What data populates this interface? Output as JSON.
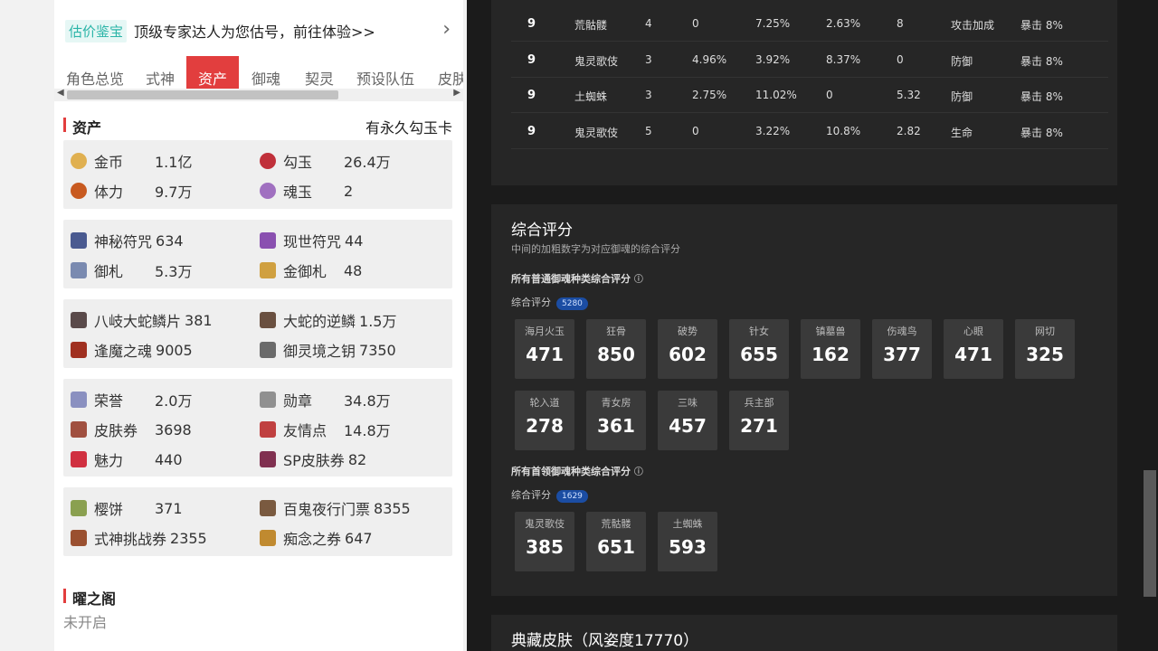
{
  "banner": {
    "tag": "估价鉴宝",
    "text": "顶级专家达人为您估号，前往体验>>",
    "chevron": "›"
  },
  "tabs": [
    "角色总览",
    "式神",
    "资产",
    "御魂",
    "契灵",
    "预设队伍",
    "皮肤"
  ],
  "active_tab": "资产",
  "assets_section": {
    "title": "资产",
    "right": "有永久勾玉卡"
  },
  "groups": [
    [
      {
        "name": "金币",
        "value": "1.1亿",
        "icon": "coin-icon",
        "color": "#e0b050"
      },
      {
        "name": "勾玉",
        "value": "26.4万",
        "icon": "jade-icon",
        "color": "#c0303a"
      },
      {
        "name": "体力",
        "value": "9.7万",
        "icon": "stamina-icon",
        "color": "#c85a20"
      },
      {
        "name": "魂玉",
        "value": "2",
        "icon": "soul-jade-icon",
        "color": "#a070c0"
      }
    ],
    [
      {
        "name": "神秘符咒",
        "value": "634",
        "icon": "mystery-talisman-icon",
        "color": "#4a5a90",
        "inline": true
      },
      {
        "name": "现世符咒",
        "value": "44",
        "icon": "reality-talisman-icon",
        "color": "#8a50b0",
        "inline": true
      },
      {
        "name": "御札",
        "value": "5.3万",
        "icon": "ofuda-icon",
        "color": "#7a8ab0"
      },
      {
        "name": "金御札",
        "value": "48",
        "icon": "gold-ofuda-icon",
        "color": "#d0a040"
      }
    ],
    [
      {
        "name": "八岐大蛇鳞片",
        "value": "381",
        "icon": "orochi-scale-icon",
        "color": "#5a4a4a",
        "inline": true
      },
      {
        "name": "大蛇的逆鳞",
        "value": "1.5万",
        "icon": "reverse-scale-icon",
        "color": "#6a5040",
        "inline": true
      },
      {
        "name": "逢魔之魂",
        "value": "9005",
        "icon": "demon-soul-icon",
        "color": "#a03020",
        "inline": true
      },
      {
        "name": "御灵境之钥",
        "value": "7350",
        "icon": "spirit-key-icon",
        "color": "#6a6a6a",
        "inline": true
      }
    ],
    [
      {
        "name": "荣誉",
        "value": "2.0万",
        "icon": "honor-icon",
        "color": "#8a90c0"
      },
      {
        "name": "勋章",
        "value": "34.8万",
        "icon": "medal-icon",
        "color": "#909090"
      },
      {
        "name": "皮肤券",
        "value": "3698",
        "icon": "skin-ticket-icon",
        "color": "#a05040"
      },
      {
        "name": "友情点",
        "value": "14.8万",
        "icon": "friendship-icon",
        "color": "#c04040"
      },
      {
        "name": "魅力",
        "value": "440",
        "icon": "charm-icon",
        "color": "#d03040"
      },
      {
        "name": "SP皮肤券",
        "value": "82",
        "icon": "sp-skin-ticket-icon",
        "color": "#803050",
        "inline": true
      }
    ],
    [
      {
        "name": "樱饼",
        "value": "371",
        "icon": "sakura-cake-icon",
        "color": "#8aa050"
      },
      {
        "name": "百鬼夜行门票",
        "value": "8355",
        "icon": "night-parade-ticket-icon",
        "color": "#7a5a40",
        "inline": true
      },
      {
        "name": "式神挑战券",
        "value": "2355",
        "icon": "challenge-ticket-icon",
        "color": "#9a5030",
        "inline": true
      },
      {
        "name": "痴念之券",
        "value": "647",
        "icon": "obsession-ticket-icon",
        "color": "#c08a30",
        "inline": true
      }
    ]
  ],
  "yao_section": {
    "title": "曜之阁",
    "status": "未开启"
  },
  "yuhun_rows": [
    {
      "level": "9",
      "name": "荒骷髅",
      "pos": "4",
      "c1": "0",
      "c2": "7.25%",
      "c3": "2.63%",
      "c4": "8",
      "main": "攻击加成",
      "sub": "暴击 8%"
    },
    {
      "level": "9",
      "name": "鬼灵歌伎",
      "pos": "3",
      "c1": "4.96%",
      "c2": "3.92%",
      "c3": "8.37%",
      "c4": "0",
      "main": "防御",
      "sub": "暴击 8%"
    },
    {
      "level": "9",
      "name": "土蜘蛛",
      "pos": "3",
      "c1": "2.75%",
      "c2": "11.02%",
      "c3": "0",
      "c4": "5.32",
      "main": "防御",
      "sub": "暴击 8%"
    },
    {
      "level": "9",
      "name": "鬼灵歌伎",
      "pos": "5",
      "c1": "0",
      "c2": "3.22%",
      "c3": "10.8%",
      "c4": "2.82",
      "main": "生命",
      "sub": "暴击 8%"
    }
  ],
  "score": {
    "title": "综合评分",
    "subtitle": "中间的加粗数字为对应御魂的综合评分",
    "normal_heading": "所有普通御魂种类综合评分",
    "label": "综合评分",
    "normal_total": "5280",
    "normal": [
      {
        "name": "海月火玉",
        "value": "471"
      },
      {
        "name": "狂骨",
        "value": "850"
      },
      {
        "name": "破势",
        "value": "602"
      },
      {
        "name": "针女",
        "value": "655"
      },
      {
        "name": "镇墓兽",
        "value": "162"
      },
      {
        "name": "伤魂鸟",
        "value": "377"
      },
      {
        "name": "心眼",
        "value": "471"
      },
      {
        "name": "网切",
        "value": "325"
      },
      {
        "name": "轮入道",
        "value": "278"
      },
      {
        "name": "青女房",
        "value": "361"
      },
      {
        "name": "三味",
        "value": "457"
      },
      {
        "name": "兵主部",
        "value": "271"
      }
    ],
    "leader_heading": "所有首领御魂种类综合评分",
    "leader_total": "1629",
    "leader": [
      {
        "name": "鬼灵歌伎",
        "value": "385"
      },
      {
        "name": "荒骷髅",
        "value": "651"
      },
      {
        "name": "土蜘蛛",
        "value": "593"
      }
    ]
  },
  "skins_title": "典藏皮肤（风姿度17770）"
}
